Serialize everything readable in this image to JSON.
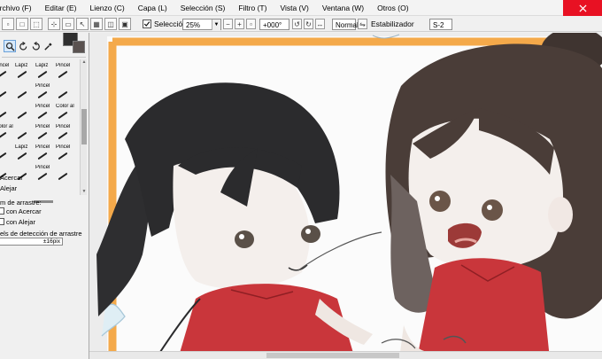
{
  "menu": {
    "items": [
      {
        "label": "Archivo (F)"
      },
      {
        "label": "Editar (E)"
      },
      {
        "label": "Lienzo (C)"
      },
      {
        "label": "Capa (L)"
      },
      {
        "label": "Selección (S)"
      },
      {
        "label": "Filtro (T)"
      },
      {
        "label": "Vista (V)"
      },
      {
        "label": "Ventana (W)"
      },
      {
        "label": "Otros (O)"
      }
    ]
  },
  "toolbar": {
    "selection_label": "Selección",
    "selection_checked": true,
    "zoom_value": "25%",
    "zoom_minus": "−",
    "zoom_plus": "+",
    "rotation_value": "+000°",
    "mode_value": "Normal",
    "stabilizer_label": "Estabilizador",
    "stabilizer_value": "S-2"
  },
  "tools": {
    "items": [
      {
        "icon": "zoom-icon"
      },
      {
        "icon": "rotate-icon"
      },
      {
        "icon": "rotate-reset-icon"
      },
      {
        "icon": "eyedropper-icon"
      }
    ],
    "main_color": "#2f2f2f",
    "sub_color": "#5a5250"
  },
  "brushes": {
    "cells": [
      {
        "label": "Pincel"
      },
      {
        "label": "Lapiz"
      },
      {
        "label": "Lapiz"
      },
      {
        "label": "Pincel"
      },
      {
        "label": ""
      },
      {
        "label": ""
      },
      {
        "label": "Pincel"
      },
      {
        "label": ""
      },
      {
        "label": ""
      },
      {
        "label": ""
      },
      {
        "label": "Pincel"
      },
      {
        "label": "Color al"
      },
      {
        "label": "Color al"
      },
      {
        "label": ""
      },
      {
        "label": "Pincel"
      },
      {
        "label": "Pincel"
      },
      {
        "label": ""
      },
      {
        "label": "Lapiz"
      },
      {
        "label": "Pincel"
      },
      {
        "label": "Pincel"
      },
      {
        "label": ""
      },
      {
        "label": ""
      },
      {
        "label": "Pincel"
      },
      {
        "label": ""
      }
    ]
  },
  "zoom_options": {
    "acercar": "Acercar",
    "alejar": "Alejar",
    "drag_heading": "m de arrastre:",
    "drag_in": "con Acercar",
    "drag_out": "con Alejar",
    "threshold_label": "els de detección de arrastre",
    "threshold_value": "±16pix"
  },
  "canvas": {
    "background": "#ececec",
    "frame_color": "#f4a94a"
  }
}
